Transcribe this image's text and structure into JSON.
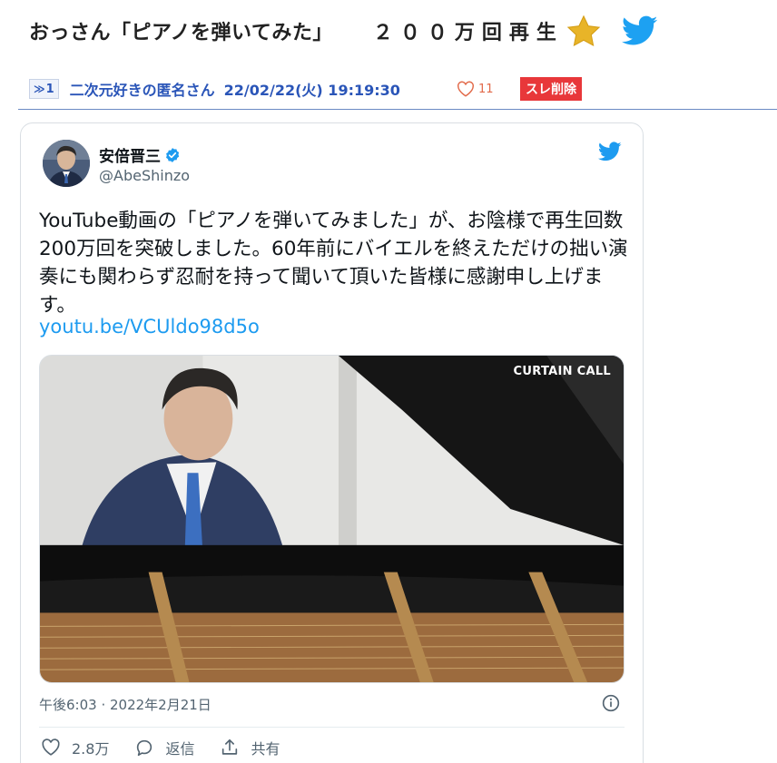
{
  "thread": {
    "title": "おっさん「ピアノを弾いてみた」",
    "views": "２００万回再生"
  },
  "post": {
    "number_prefix": "≫",
    "number": "1",
    "name": "二次元好きの匿名さん",
    "date": "22/02/22(火) 19:19:30",
    "likes": "11",
    "delete_label": "スレ削除"
  },
  "tweet": {
    "author_name": "安倍晋三",
    "handle": "@AbeShinzo",
    "text": "YouTube動画の「ピアノを弾いてみました」が、お陰様で再生回数200万回を突破しました。60年前にバイエルを終えただけの拙い演奏にも関わらず忍耐を持って聞いて頂いた皆様に感謝申し上げます。",
    "link": "youtu.be/VCUldo98d5o",
    "media_overlay": "CURTAIN CALL",
    "timestamp": "午後6:03 · 2022年2月21日",
    "likes": "2.8万",
    "reply_label": "返信",
    "share_label": "共有"
  },
  "colors": {
    "accent_blue": "#1d9bf0",
    "link_blue": "#2a55b8",
    "delete_red": "#e8373a",
    "star_gold": "#f0b90f"
  }
}
